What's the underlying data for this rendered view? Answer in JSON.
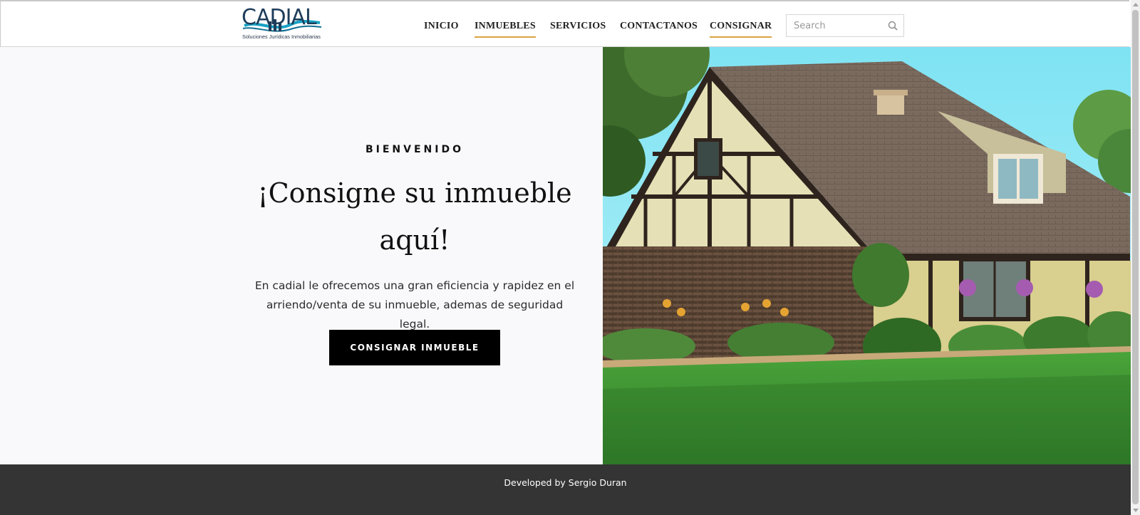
{
  "header": {
    "logo": {
      "wordmark": "CADIAL",
      "tagline": "Soluciones Jurídicas Inmobiliarias",
      "colors": {
        "navy": "#1e3d5a",
        "teal": "#18a2c4"
      }
    },
    "nav": [
      {
        "label": "INICIO",
        "active": false
      },
      {
        "label": "INMUEBLES",
        "active": true
      },
      {
        "label": "SERVICIOS",
        "active": false
      },
      {
        "label": "CONTACTANOS",
        "active": false
      },
      {
        "label": "CONSIGNAR",
        "active": true
      }
    ],
    "search": {
      "placeholder": "Search",
      "value": "",
      "icon": "search-icon"
    },
    "accent_color": "#d9a441"
  },
  "hero": {
    "eyebrow": "BIENVENIDO",
    "headline_line1": "¡Consigne su inmueble",
    "headline_line2": "aquí!",
    "lead_line1": "En cadial le ofrecemos una gran eficiencia y rapidez en el",
    "lead_line2": "arriendo/venta de su inmueble, ademas de seguridad legal.",
    "cta_label": "CONSIGNAR INMUEBLE",
    "image": "tudor-style-house-photo"
  },
  "footer": {
    "text": "Developed by Sergio Duran",
    "background": "#343434"
  }
}
